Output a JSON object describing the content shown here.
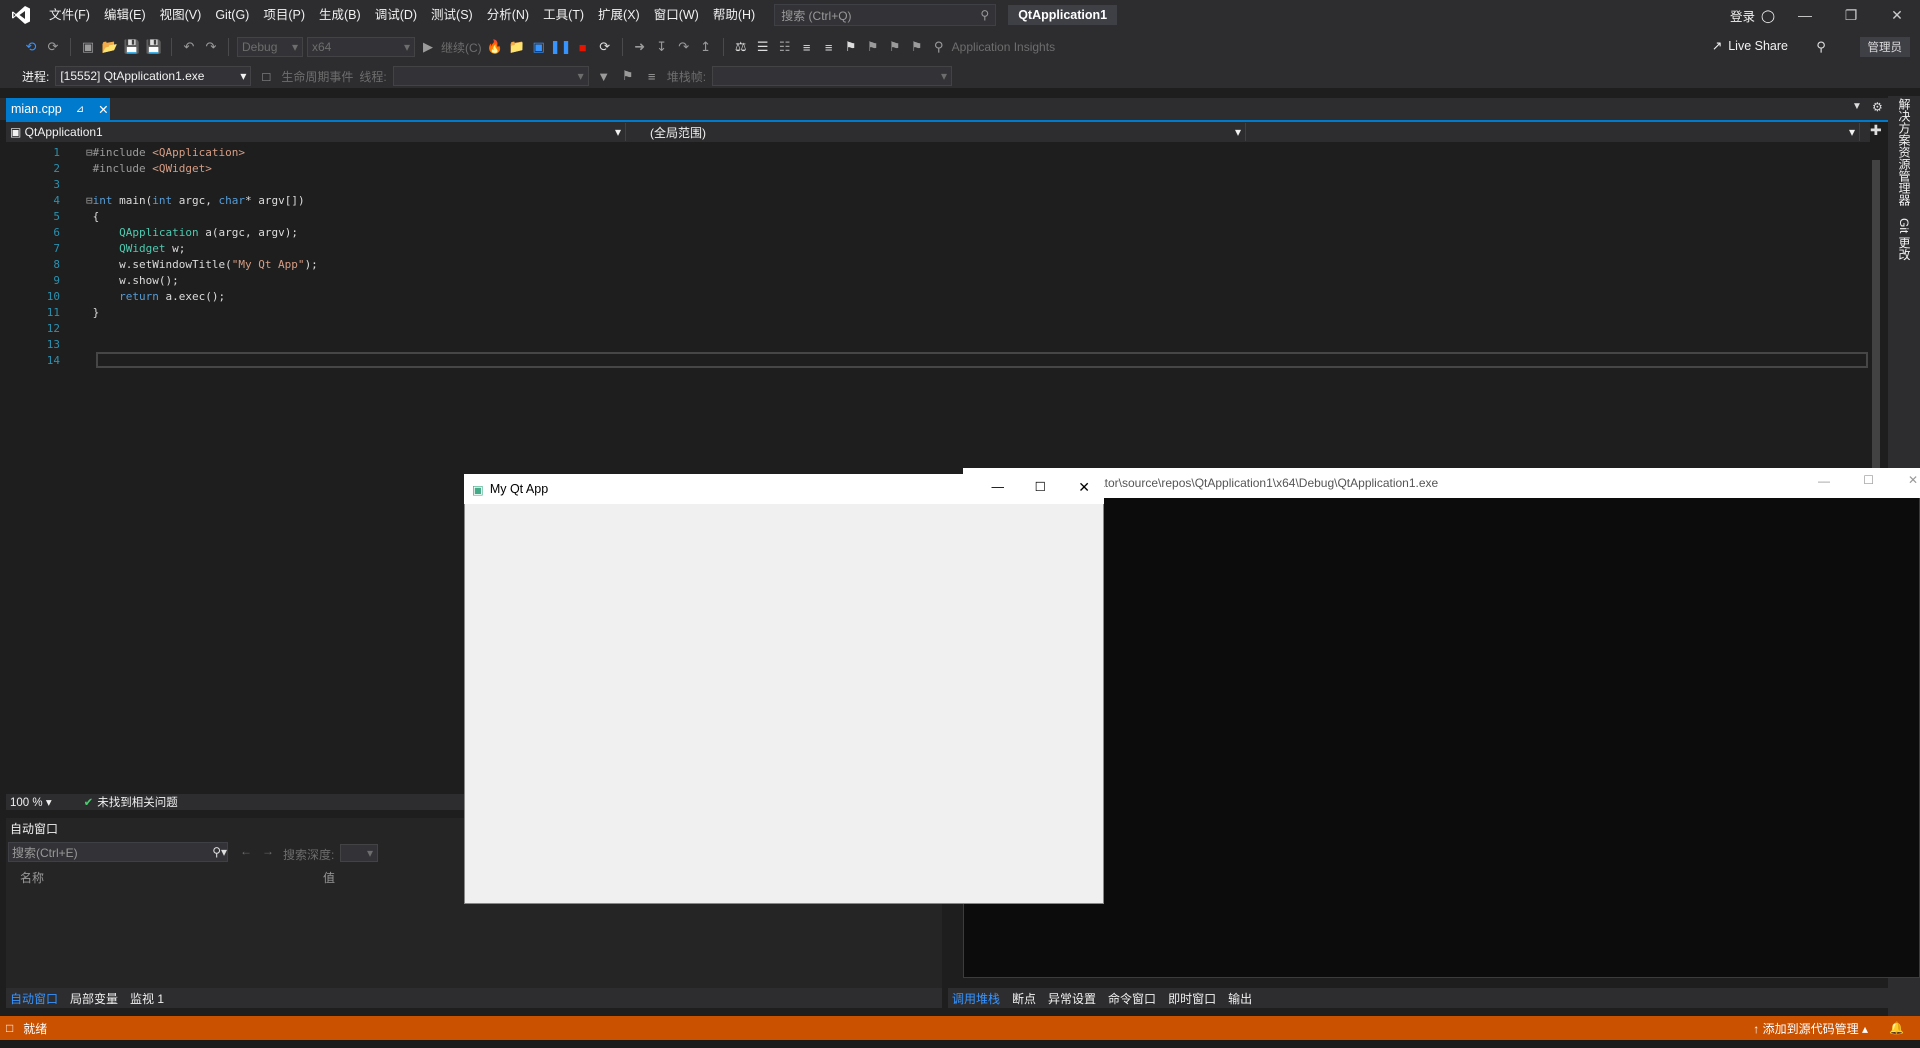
{
  "menubar": {
    "items": [
      "文件(F)",
      "编辑(E)",
      "视图(V)",
      "Git(G)",
      "项目(P)",
      "生成(B)",
      "调试(D)",
      "测试(S)",
      "分析(N)",
      "工具(T)",
      "扩展(X)",
      "窗口(W)",
      "帮助(H)"
    ],
    "search_placeholder": "搜索 (Ctrl+Q)",
    "solution_name": "QtApplication1",
    "login": "登录"
  },
  "toolbar": {
    "config": "Debug",
    "platform": "x64",
    "continue": "继续(C)",
    "app_insights": "Application Insights",
    "live_share": "Live Share",
    "admin": "管理员"
  },
  "debugbar": {
    "process_label": "进程:",
    "process_value": "[15552] QtApplication1.exe",
    "lifecycle": "生命周期事件",
    "thread_label": "线程:",
    "stack_label": "堆栈帧:"
  },
  "editor": {
    "tab_name": "mian.cpp",
    "nav_project": "QtApplication1",
    "nav_scope": "(全局范围)",
    "line_numbers": [
      "1",
      "2",
      "3",
      "4",
      "5",
      "6",
      "7",
      "8",
      "9",
      "10",
      "11",
      "12",
      "13",
      "14"
    ],
    "zoom": "100 %",
    "issues": "未找到相关问题"
  },
  "autos": {
    "title": "自动窗口",
    "search_placeholder": "搜索(Ctrl+E)",
    "search_depth": "搜索深度:",
    "col_name": "名称",
    "col_value": "值"
  },
  "bottom_tabs_left": [
    "自动窗口",
    "局部变量",
    "监视 1"
  ],
  "bottom_tabs_right": [
    "调用堆栈",
    "断点",
    "异常设置",
    "命令窗口",
    "即时窗口",
    "输出"
  ],
  "right_rail": [
    "解决方案资源管理器",
    "Git 更改"
  ],
  "console": {
    "title": "ator\\source\\repos\\QtApplication1\\x64\\Debug\\QtApplication1.exe"
  },
  "qt_window": {
    "title": "My Qt App"
  },
  "statusbar": {
    "ready": "就绪",
    "source_control": "添加到源代码管理"
  },
  "colors": {
    "accent": "#007acc",
    "status": "#ca5100"
  }
}
